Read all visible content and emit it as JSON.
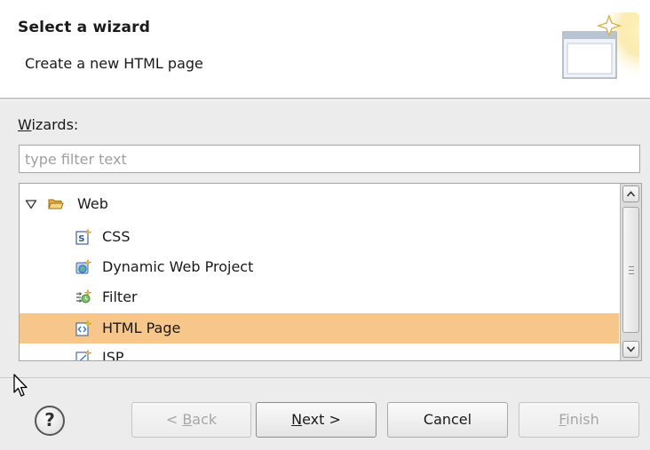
{
  "header": {
    "title": "Select a wizard",
    "subtitle": "Create a new HTML page",
    "banner_icon": "new-wizard-banner-icon"
  },
  "wizards_label": {
    "mnemonic": "W",
    "rest": "izards:"
  },
  "filter": {
    "placeholder": "type filter text",
    "value": ""
  },
  "tree": {
    "items": [
      {
        "label": "Web",
        "icon": "folder-open-icon",
        "expanded": true,
        "level": 0
      },
      {
        "label": "CSS",
        "icon": "css-file-icon",
        "level": 1
      },
      {
        "label": "Dynamic Web Project",
        "icon": "web-project-icon",
        "level": 1
      },
      {
        "label": "Filter",
        "icon": "filter-icon",
        "level": 1
      },
      {
        "label": "HTML Page",
        "icon": "html-page-icon",
        "level": 1,
        "selected": true
      },
      {
        "label": "JSP",
        "icon": "jsp-file-icon",
        "level": 1
      }
    ],
    "selection_color": "#f6c68b"
  },
  "buttons": {
    "help_glyph": "?",
    "back": {
      "prefix": "< ",
      "mnemonic": "B",
      "rest": "ack"
    },
    "next": {
      "mnemonic": "N",
      "rest": "ext >"
    },
    "cancel": "Cancel",
    "finish": {
      "mnemonic": "F",
      "rest": "inish"
    }
  }
}
